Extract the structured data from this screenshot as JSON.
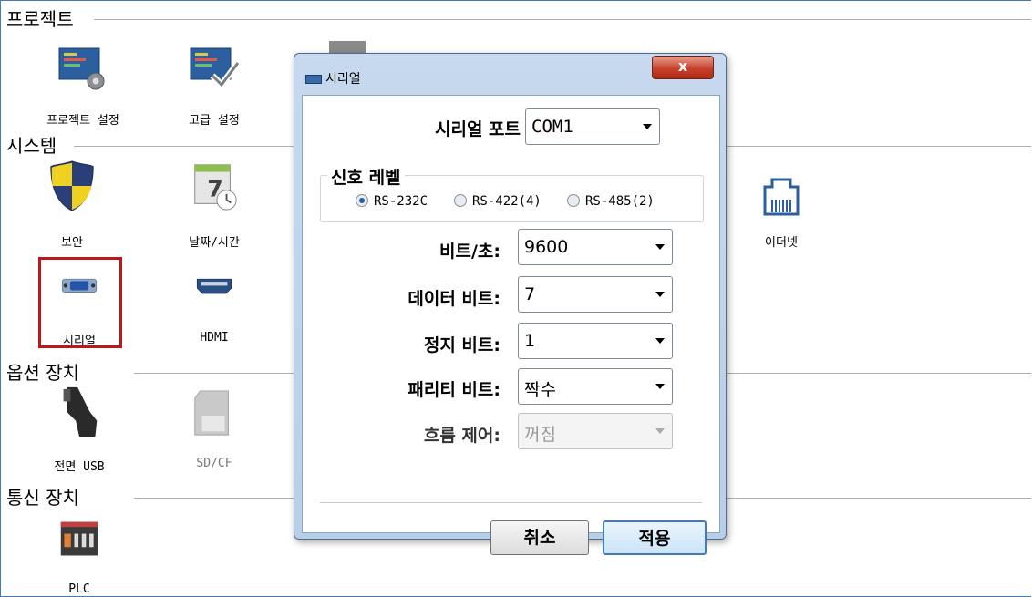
{
  "sections": {
    "project": "프로젝트",
    "system": "시스템",
    "options": "옵션 장치",
    "comm": "통신 장치"
  },
  "tiles": {
    "project_settings": "프로젝트 설정",
    "advanced_settings": "고급 설정",
    "security": "보안",
    "datetime": "날짜/시간",
    "ethernet": "이더넷",
    "serial": "시리얼",
    "hdmi": "HDMI",
    "front_usb": "전면 USB",
    "sdcf": "SD/CF",
    "plc": "PLC"
  },
  "dialog": {
    "title": "시리얼",
    "close_label": "x",
    "port_label": "시리얼 포트",
    "port_value": "COM1",
    "signal_level_label": "신호 레벨",
    "signal_options": [
      "RS-232C",
      "RS-422(4)",
      "RS-485(2)"
    ],
    "signal_selected": "RS-232C",
    "baud_label": "비트/초:",
    "baud_value": "9600",
    "data_bits_label": "데이터 비트:",
    "data_bits_value": "7",
    "stop_bits_label": "정지 비트:",
    "stop_bits_value": "1",
    "parity_label": "패리티 비트:",
    "parity_value": "짝수",
    "flow_label": "흐름 제어:",
    "flow_value": "꺼짐",
    "cancel_label": "취소",
    "apply_label": "적용"
  },
  "colors": {
    "selection_border": "#c0151b",
    "accent": "#3d7bc8"
  }
}
